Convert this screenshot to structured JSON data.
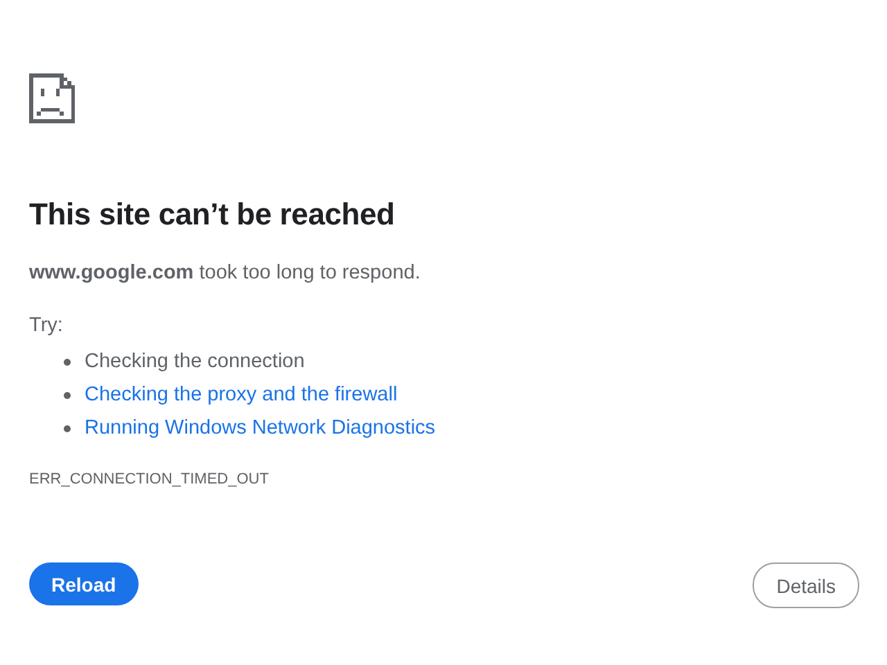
{
  "heading": "This site can’t be reached",
  "message": "**www.google.com** took too long to respond.",
  "try_label": "Try:",
  "suggestions": [
    {
      "kind": "text",
      "text": "Checking the connection"
    },
    {
      "kind": "link",
      "text": "Checking the proxy and the firewall"
    },
    {
      "kind": "link",
      "text": "Running Windows Network Diagnostics"
    }
  ],
  "error_code": "ERR_CONNECTION_TIMED_OUT",
  "buttons": {
    "primary": "Reload",
    "secondary": "Details"
  }
}
